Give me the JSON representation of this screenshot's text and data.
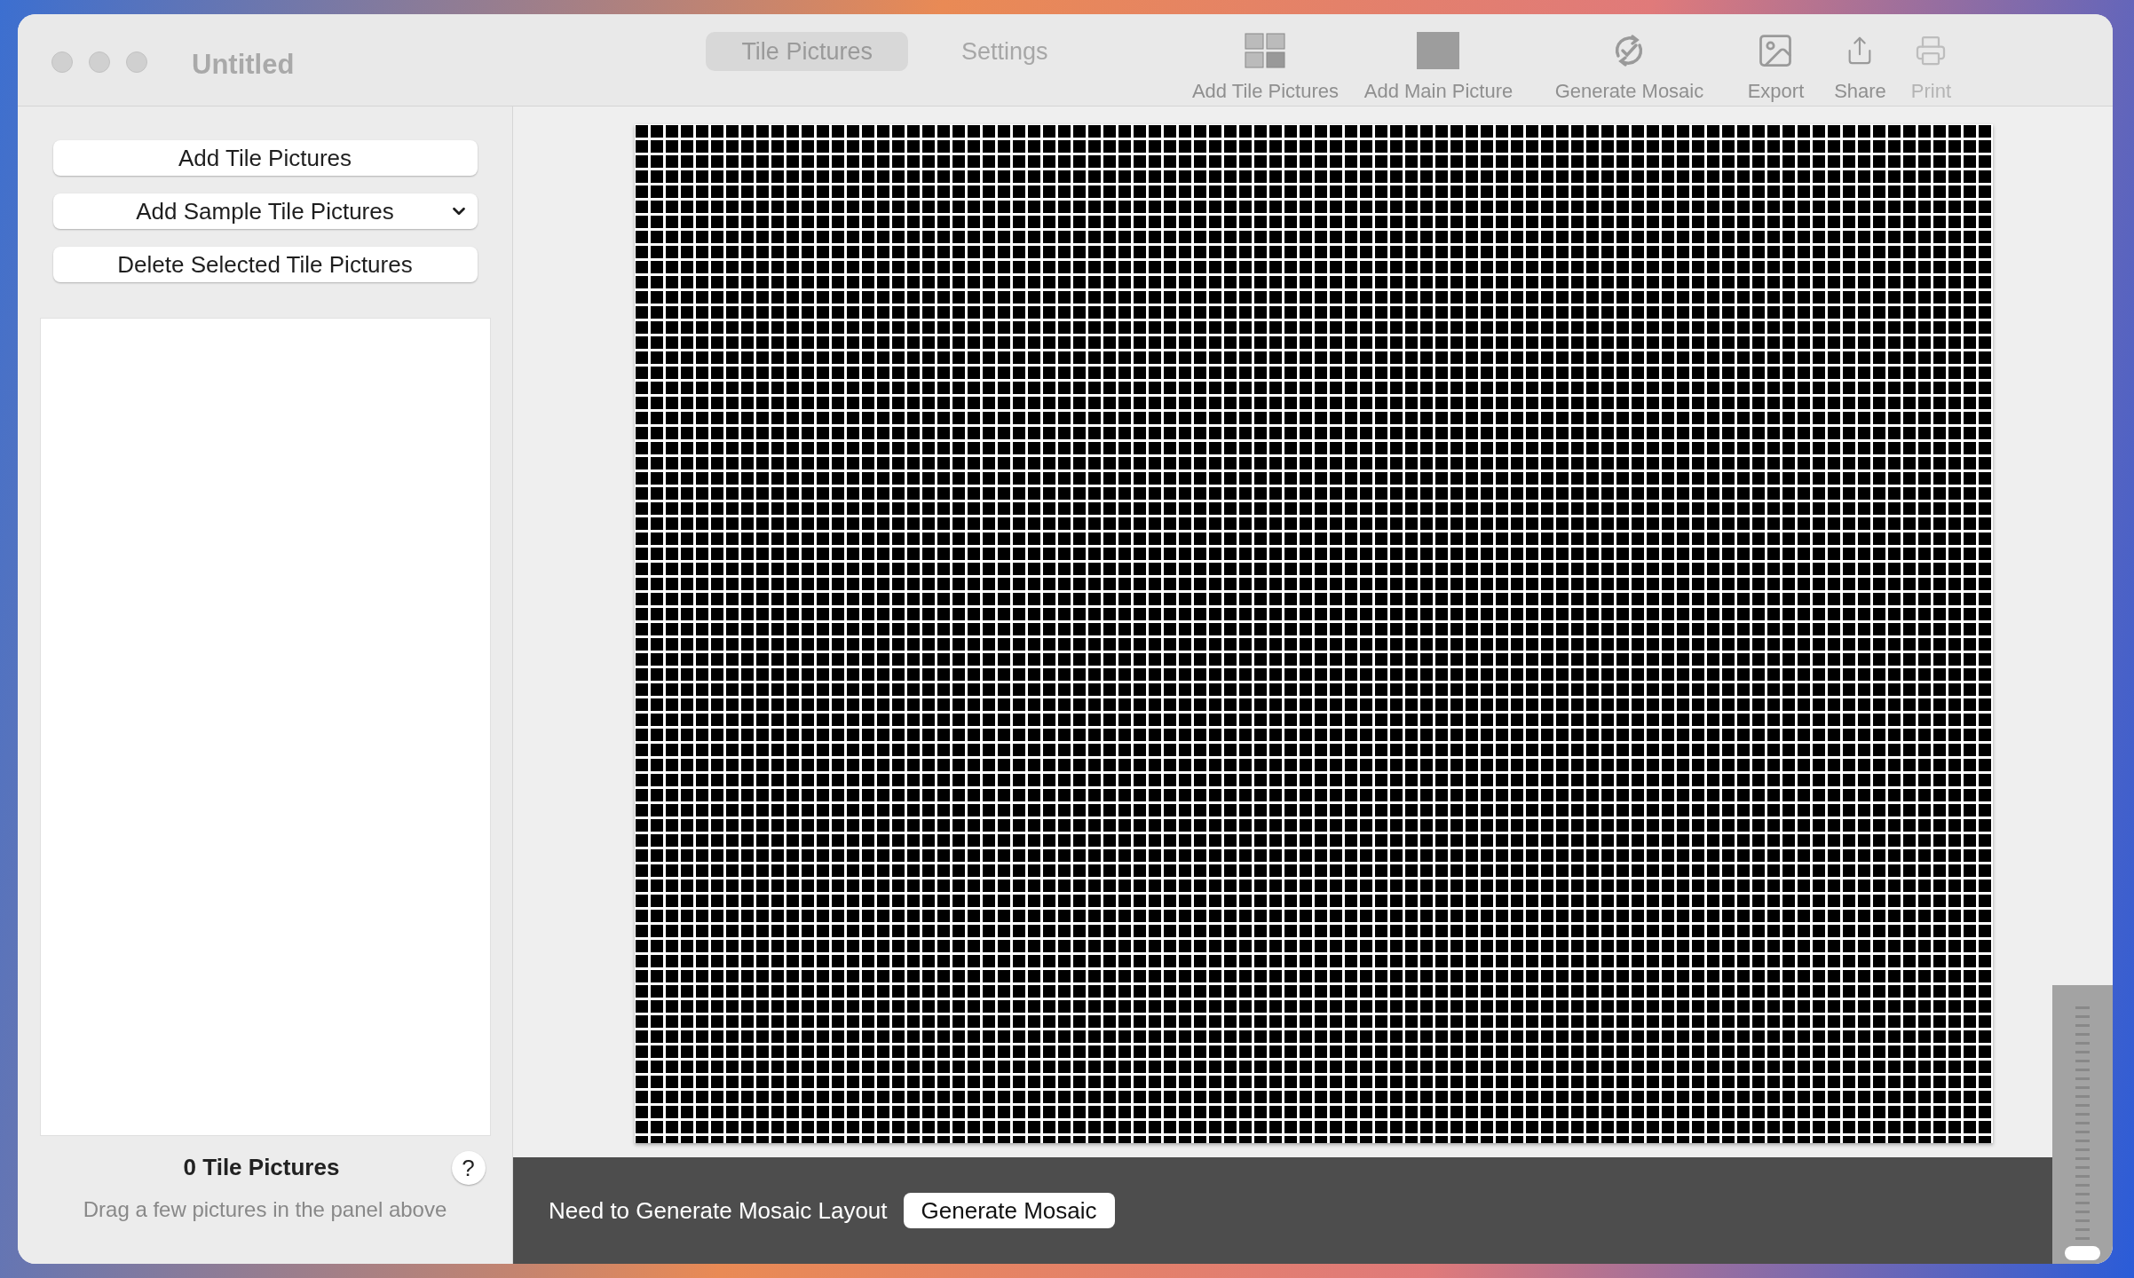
{
  "window": {
    "title": "Untitled"
  },
  "tabs": [
    {
      "label": "Tile Pictures",
      "selected": true
    },
    {
      "label": "Settings",
      "selected": false
    }
  ],
  "toolbar": [
    {
      "kind": "tiles",
      "label": "Add Tile Pictures",
      "disabled": false
    },
    {
      "kind": "main",
      "label": "Add Main Picture",
      "disabled": false
    },
    {
      "kind": "generate",
      "label": "Generate Mosaic",
      "disabled": false
    },
    {
      "kind": "export",
      "label": "Export",
      "disabled": false
    },
    {
      "kind": "share",
      "label": "Share",
      "disabled": false
    },
    {
      "kind": "print",
      "label": "Print",
      "disabled": true
    }
  ],
  "sidebar": {
    "buttons": [
      {
        "kind": "button",
        "label": "Add Tile Pictures"
      },
      {
        "kind": "dropdown",
        "label": "Add Sample Tile Pictures"
      },
      {
        "kind": "button",
        "label": "Delete Selected Tile Pictures"
      }
    ],
    "count": "0 Tile Pictures",
    "help": "?",
    "hint": "Drag a few pictures in the panel above"
  },
  "status_bar": {
    "message": "Need to Generate Mosaic Layout",
    "button": "Generate Mosaic"
  },
  "zoom_slider": {
    "level": 0
  }
}
